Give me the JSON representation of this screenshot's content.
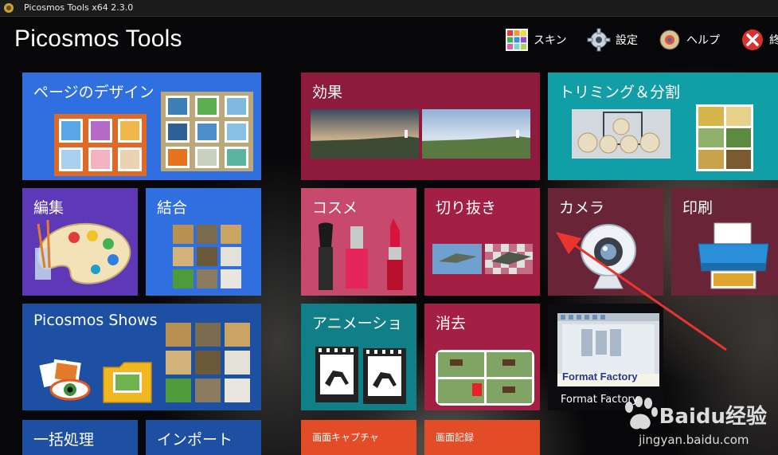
{
  "window": {
    "title": "Picosmos Tools x64 2.3.0"
  },
  "header": {
    "app_title": "Picosmos Tools",
    "buttons": {
      "skin": "スキン",
      "settings": "設定",
      "help": "ヘルプ",
      "exit": "終"
    }
  },
  "tiles": {
    "page_design": "ページのデザイン",
    "edit": "編集",
    "combine": "結合",
    "shows": "Picosmos Shows",
    "batch": "一括処理",
    "import": "インポート",
    "effects": "効果",
    "trim_split": "トリミング＆分割",
    "cosme": "コスメ",
    "cutout": "切り抜き",
    "camera": "カメラ",
    "print": "印刷",
    "animation": "アニメーショ",
    "erase": "消去",
    "format_factory": "Format Factory",
    "format_factory_logo": "Format Factory",
    "screen_capture": "画面キャプチャ",
    "screen_record": "画面記録"
  },
  "watermark": {
    "brand": "Baidu经验",
    "url": "jingyan.baidu.com"
  },
  "colors": {
    "blue_tile": "#2f6fe0",
    "purple_tile": "#5d39b8",
    "navy_tile": "#1d4fa3",
    "maroon_tile": "#8e1a3e",
    "teal_tile": "#119ea6",
    "pink_tile": "#c74a6c",
    "dark_maroon": "#6a2437",
    "orange_tile": "#e24c27",
    "arrow": "#e8352f"
  }
}
